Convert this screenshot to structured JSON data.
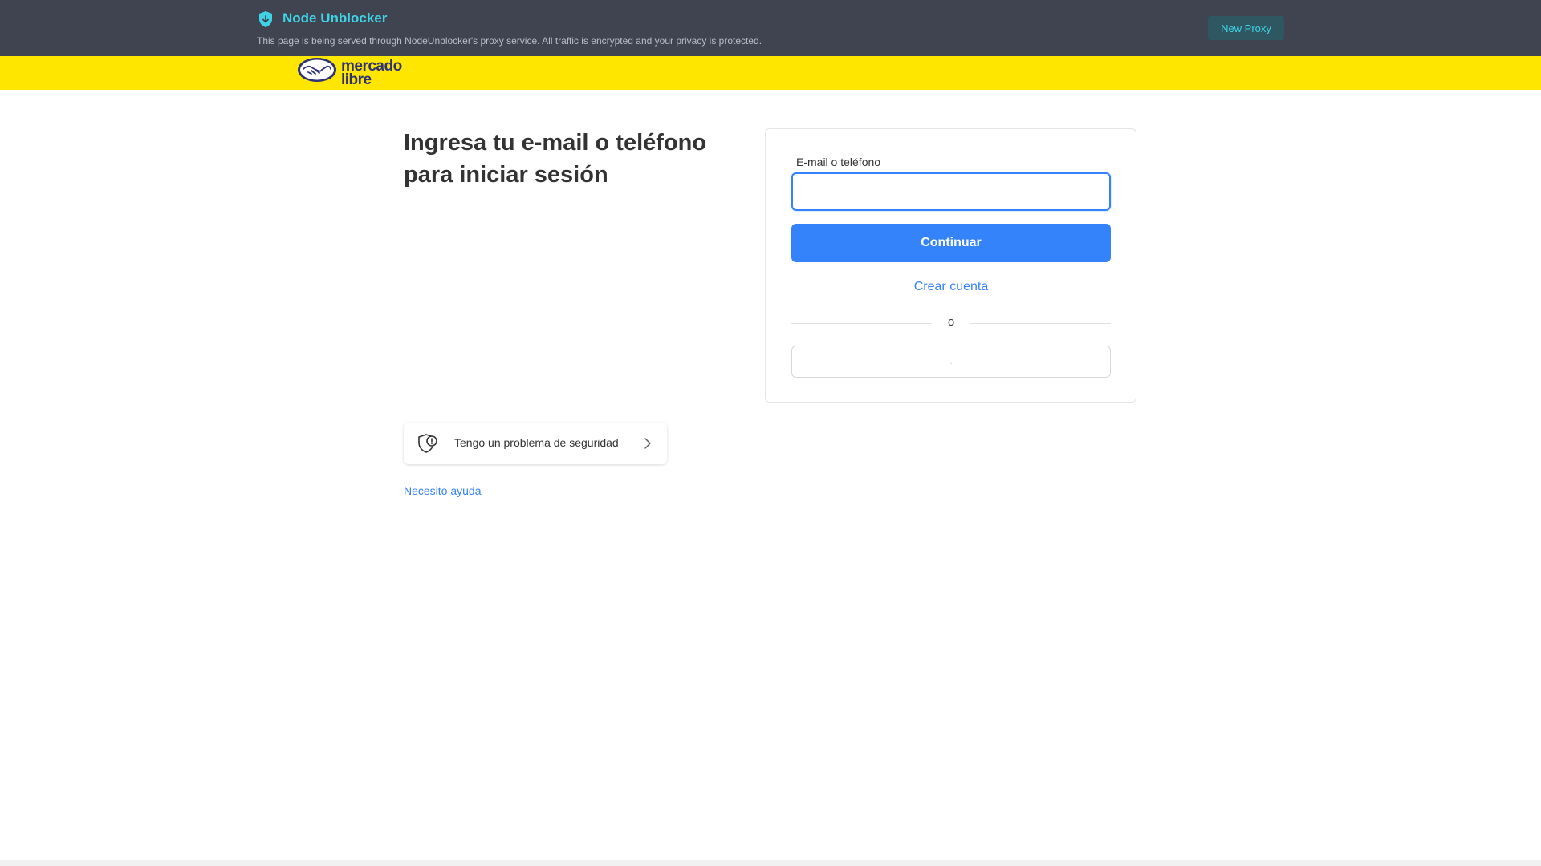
{
  "proxy": {
    "title": "Node Unblocker",
    "notice": "This page is being served through NodeUnblocker's proxy service. All traffic is encrypted and your privacy is protected.",
    "new_proxy_label": "New Proxy",
    "accent_color": "#3fd3e6",
    "bar_color": "#3f4450"
  },
  "header": {
    "logo_text_line1": "mercado",
    "logo_text_line2": "libre",
    "background_color": "#ffe600"
  },
  "login": {
    "heading": "Ingresa tu e-mail o teléfono para iniciar sesión",
    "field_label": "E-mail o teléfono",
    "email_value": "",
    "continue_label": "Continuar",
    "create_account_label": "Crear cuenta",
    "divider_text": "o",
    "alt_button_label": ".",
    "primary_color": "#3483fa"
  },
  "security": {
    "label": "Tengo un problema de seguridad"
  },
  "help": {
    "label": "Necesito ayuda"
  }
}
